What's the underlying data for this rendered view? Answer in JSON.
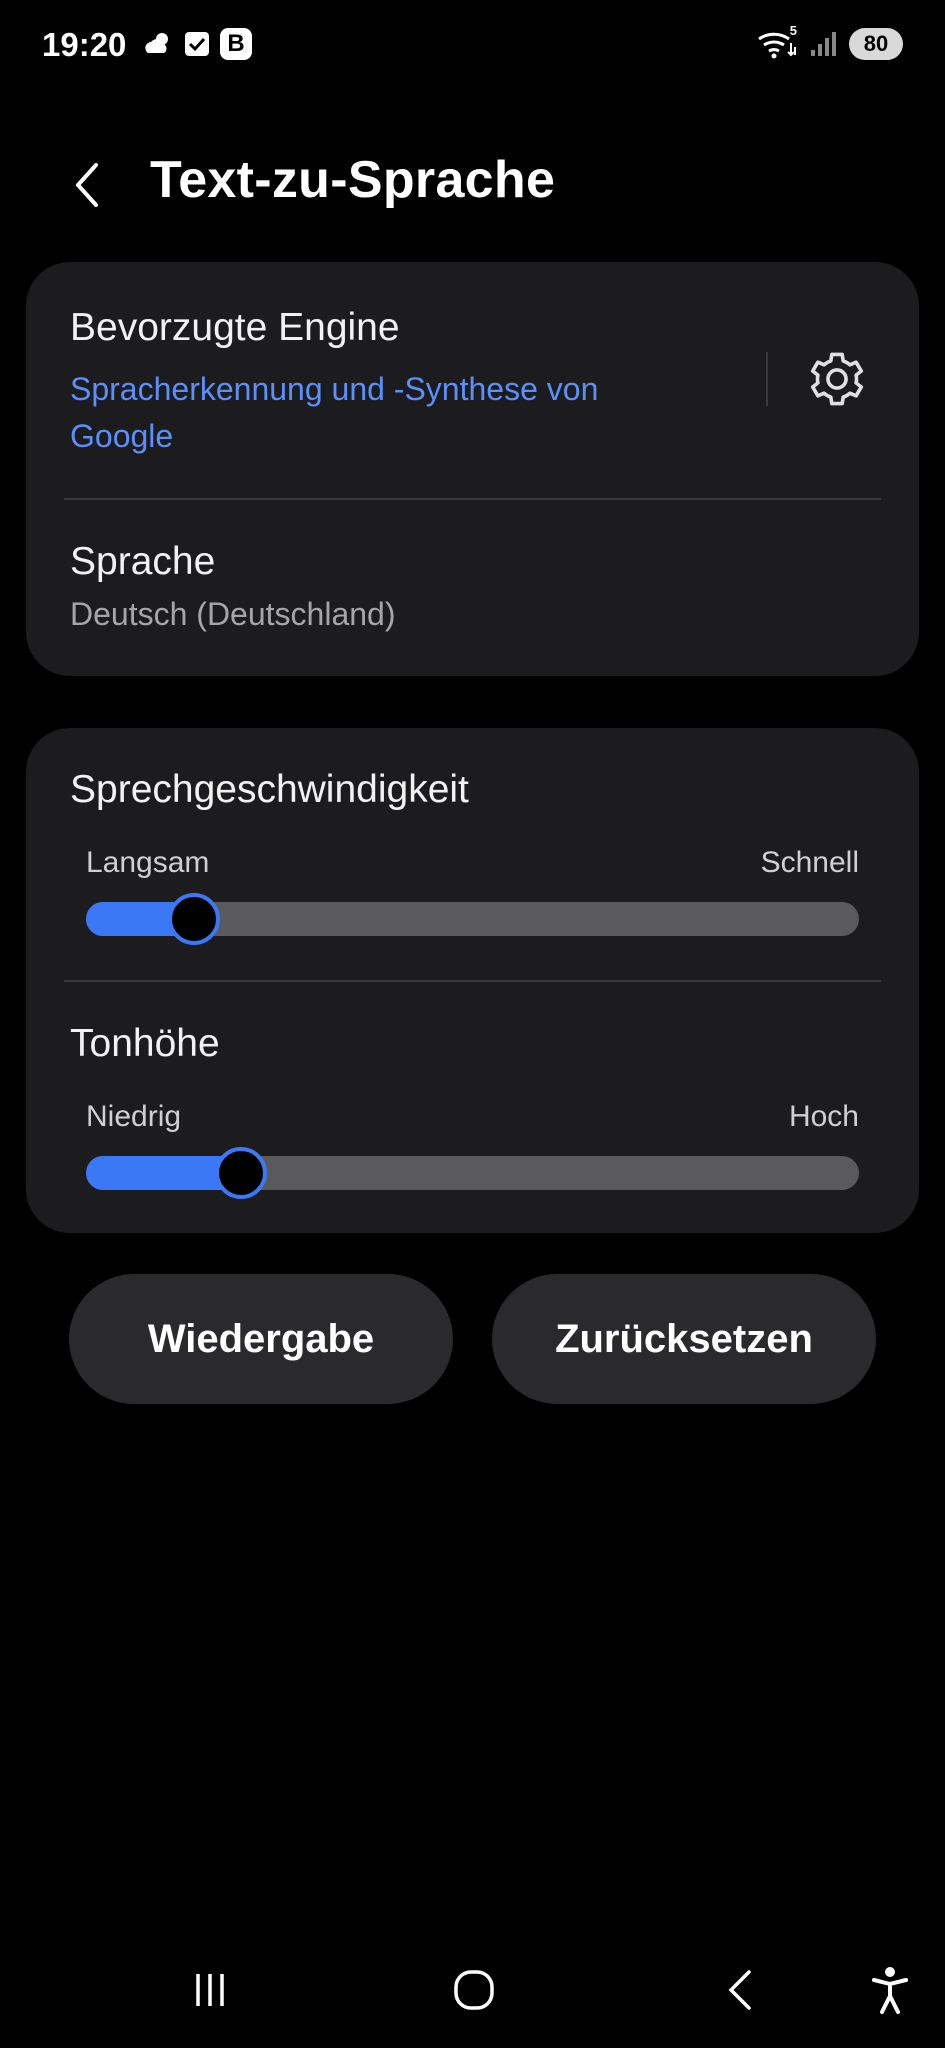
{
  "status_bar": {
    "time": "19:20",
    "battery": "80",
    "left_icons": [
      "weather-cloud-sun-icon",
      "checkbox-icon",
      "b-app-icon"
    ],
    "right_icons": [
      "wifi-icon",
      "signal-icon",
      "battery-icon"
    ],
    "b_app_letter": "B",
    "wifi_badge": "5"
  },
  "header": {
    "title": "Text-zu-Sprache"
  },
  "engine": {
    "label": "Bevorzugte Engine",
    "value": "Spracherkennung und -Synthese von Google"
  },
  "language": {
    "label": "Sprache",
    "value": "Deutsch (Deutschland)"
  },
  "speech_rate": {
    "label": "Sprechgeschwindigkeit",
    "min_label": "Langsam",
    "max_label": "Schnell",
    "level": 0.14
  },
  "pitch": {
    "label": "Tonhöhe",
    "min_label": "Niedrig",
    "max_label": "Hoch",
    "level": 0.2
  },
  "buttons": {
    "play": "Wiedergabe",
    "reset": "Zurücksetzen"
  },
  "nav": {
    "items": [
      "recent-apps-icon",
      "home-icon",
      "back-icon",
      "accessibility-icon"
    ]
  },
  "colors": {
    "accent": "#3b78f5",
    "link": "#5b8ff9",
    "card": "#1c1c1e",
    "background": "#000000"
  }
}
